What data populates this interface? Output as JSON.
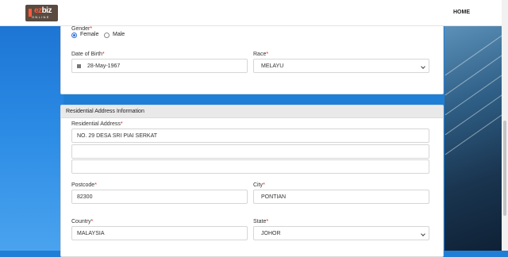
{
  "nav": {
    "logo_main": "ez",
    "logo_accent": "biz",
    "logo_sub": "ONLINE",
    "home_label": "HOME"
  },
  "personal": {
    "gender_label": "Gender",
    "gender_options": [
      "Female",
      "Male"
    ],
    "gender_selected": "Female",
    "dob_label": "Date of Birth",
    "dob_value": "28-May-1967",
    "race_label": "Race",
    "race_value": "MELAYU"
  },
  "address": {
    "section_title": "Residential Address Information",
    "address_label": "Residential Address",
    "address_line1": "NO. 29 DESA SRI PIAI SERKAT",
    "address_line2": "",
    "address_line3": "",
    "postcode_label": "Postcode",
    "postcode_value": "82300",
    "city_label": "City",
    "city_value": "PONTIAN",
    "country_label": "Country",
    "country_value": "MALAYSIA",
    "state_label": "State",
    "state_value": "JOHOR"
  },
  "required_mark": "*"
}
